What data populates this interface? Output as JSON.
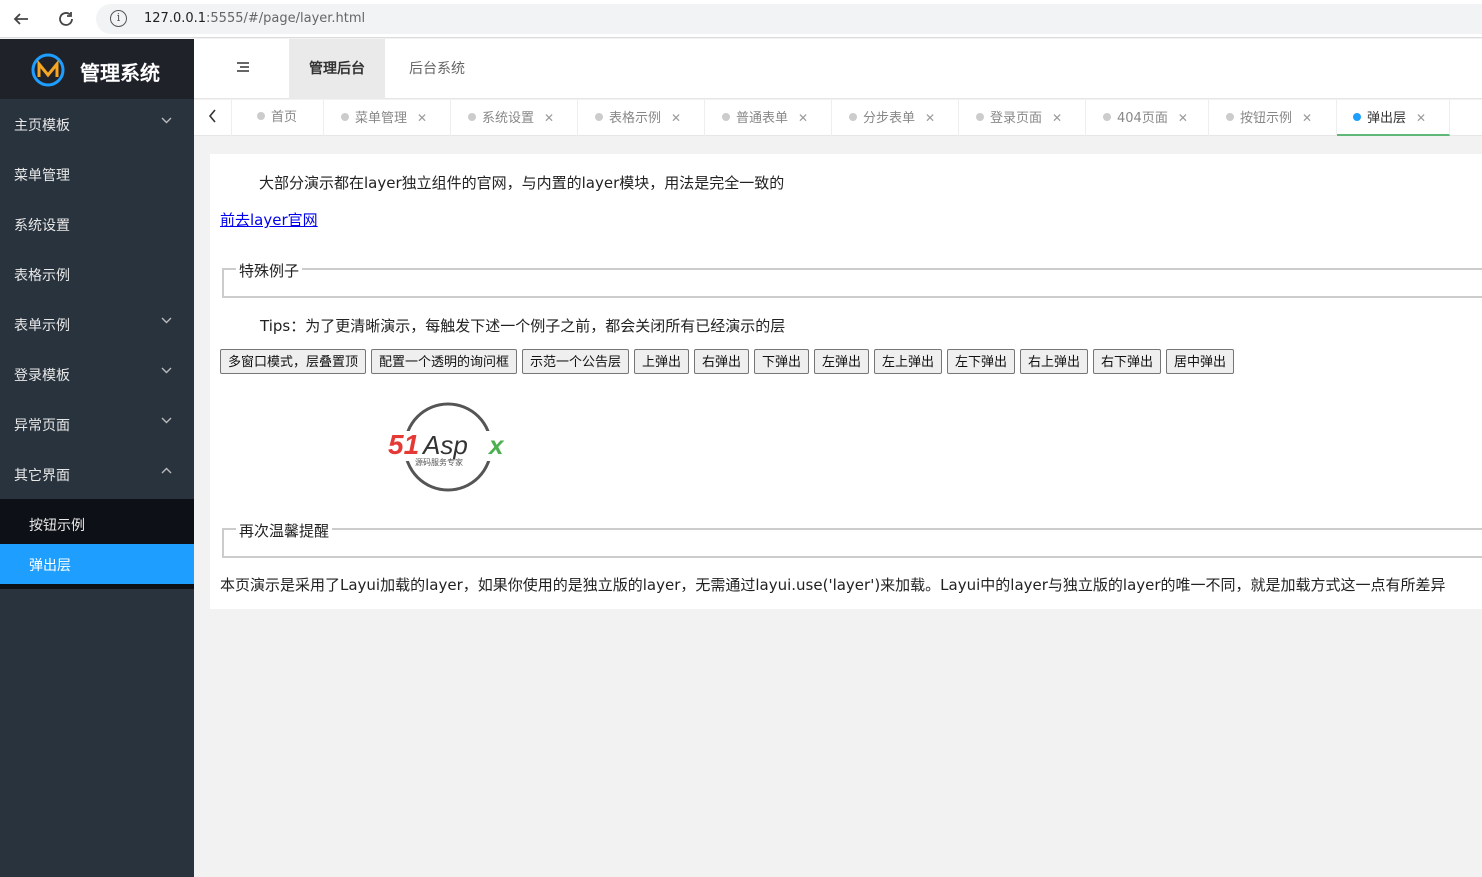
{
  "browser": {
    "url_host": "127.0.0.1",
    "url_rest": ":5555/#/page/layer.html",
    "back_icon": "arrow-left-icon",
    "reload_icon": "reload-icon",
    "info_icon": "info-icon"
  },
  "sidebar": {
    "title": "管理系统",
    "items": [
      {
        "label": "主页模板",
        "chevron": "down"
      },
      {
        "label": "菜单管理",
        "chevron": ""
      },
      {
        "label": "系统设置",
        "chevron": ""
      },
      {
        "label": "表格示例",
        "chevron": ""
      },
      {
        "label": "表单示例",
        "chevron": "down"
      },
      {
        "label": "登录模板",
        "chevron": "down"
      },
      {
        "label": "异常页面",
        "chevron": "down"
      },
      {
        "label": "其它界面",
        "chevron": "up"
      }
    ],
    "sub_items": [
      {
        "label": "按钮示例",
        "active": false
      },
      {
        "label": "弹出层",
        "active": true
      }
    ]
  },
  "header": {
    "menu_icon": "hamburger-icon",
    "nav": [
      {
        "label": "管理后台",
        "active": true
      },
      {
        "label": "后台系统",
        "active": false
      }
    ]
  },
  "tabs": [
    {
      "label": "首页",
      "closable": false,
      "active": false
    },
    {
      "label": "菜单管理",
      "closable": true,
      "active": false
    },
    {
      "label": "系统设置",
      "closable": true,
      "active": false
    },
    {
      "label": "表格示例",
      "closable": true,
      "active": false
    },
    {
      "label": "普通表单",
      "closable": true,
      "active": false
    },
    {
      "label": "分步表单",
      "closable": true,
      "active": false
    },
    {
      "label": "登录页面",
      "closable": true,
      "active": false
    },
    {
      "label": "404页面",
      "closable": true,
      "active": false
    },
    {
      "label": "按钮示例",
      "closable": true,
      "active": false
    },
    {
      "label": "弹出层",
      "closable": true,
      "active": true
    }
  ],
  "content": {
    "intro": "大部分演示都在layer独立组件的官网，与内置的layer模块，用法是完全一致的",
    "link": "前去layer官网",
    "fieldset1": "特殊例子",
    "tips": "Tips：为了更清晰演示，每触发下述一个例子之前，都会关闭所有已经演示的层",
    "buttons": [
      "多窗口模式，层叠置顶",
      "配置一个透明的询问框",
      "示范一个公告层",
      "上弹出",
      "右弹出",
      "下弹出",
      "左弹出",
      "左上弹出",
      "左下弹出",
      "右上弹出",
      "右下弹出",
      "居中弹出"
    ],
    "logo_text": "51Aspx",
    "logo_sub": "源码服务专家",
    "fieldset2": "再次温馨提醒",
    "notice": "本页演示是采用了Layui加载的layer，如果你使用的是独立版的layer，无需通过layui.use('layer')来加载。Layui中的layer与独立版的layer的唯一不同，就是加载方式这一点有所差异"
  },
  "colors": {
    "sidebar_bg": "#28333e",
    "sidebar_sub_bg": "#0d1016",
    "active_blue": "#1e9fff",
    "tab_active_underline": "#5fb878"
  }
}
